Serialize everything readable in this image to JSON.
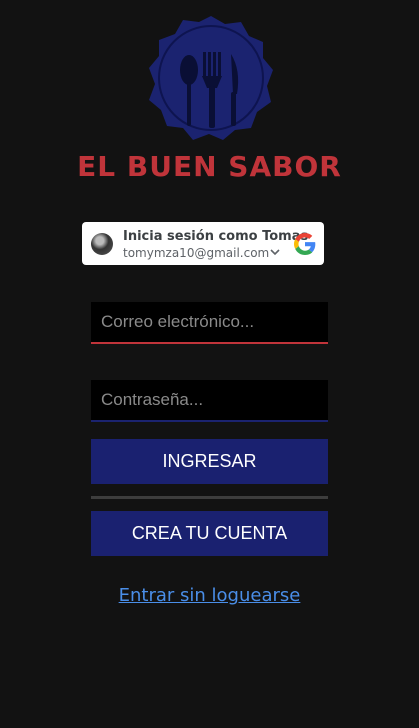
{
  "brand": {
    "name": "EL BUEN SABOR",
    "color": "#c0343a"
  },
  "google_signin": {
    "title": "Inicia sesión como Tomas",
    "email": "tomymza10@gmail.com",
    "icon": "google-icon"
  },
  "form": {
    "email_placeholder": "Correo electrónico...",
    "password_placeholder": "Contraseña...",
    "login_label": "INGRESAR",
    "register_label": "CREA TU CUENTA"
  },
  "guest_link": "Entrar sin loguearse",
  "colors": {
    "primary_button": "#1a2170",
    "background": "#121212",
    "link": "#4a8ee8"
  }
}
